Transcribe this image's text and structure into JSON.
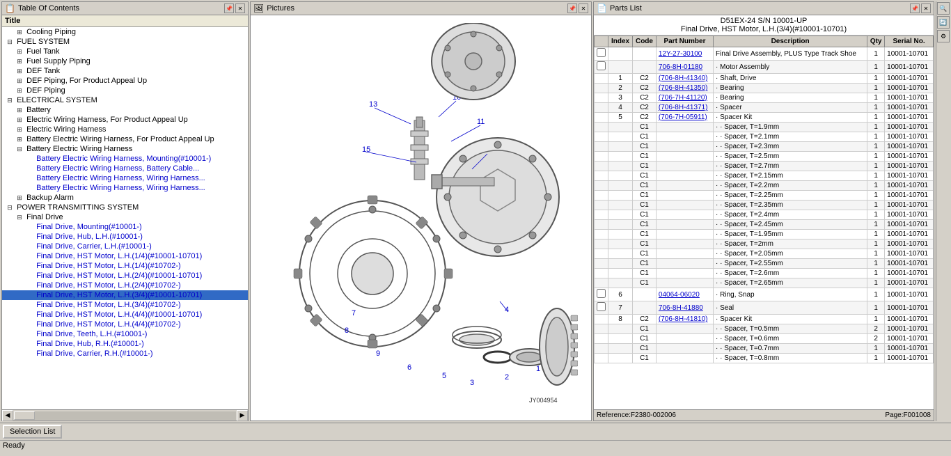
{
  "app": {
    "title": "Table Of Contents",
    "pictures_title": "Pictures",
    "parts_list_title": "Parts List"
  },
  "toc": {
    "title": "Title",
    "items": [
      {
        "id": "cooling",
        "label": "Cooling Piping",
        "indent": 2,
        "expandable": true,
        "type": "leaf"
      },
      {
        "id": "fuel_sys",
        "label": "FUEL SYSTEM",
        "indent": 1,
        "expandable": true,
        "type": "section"
      },
      {
        "id": "fuel_tank",
        "label": "Fuel Tank",
        "indent": 2,
        "expandable": true,
        "type": "leaf"
      },
      {
        "id": "fuel_supply",
        "label": "Fuel Supply Piping",
        "indent": 2,
        "expandable": true,
        "type": "leaf"
      },
      {
        "id": "def_tank",
        "label": "DEF Tank",
        "indent": 2,
        "expandable": true,
        "type": "leaf"
      },
      {
        "id": "def_piping_appeal",
        "label": "DEF Piping, For Product Appeal Up",
        "indent": 2,
        "expandable": true,
        "type": "leaf"
      },
      {
        "id": "def_piping",
        "label": "DEF Piping",
        "indent": 2,
        "expandable": true,
        "type": "leaf"
      },
      {
        "id": "elec_sys",
        "label": "ELECTRICAL SYSTEM",
        "indent": 1,
        "expandable": true,
        "type": "section"
      },
      {
        "id": "battery",
        "label": "Battery",
        "indent": 2,
        "expandable": true,
        "type": "leaf"
      },
      {
        "id": "elec_harness_appeal",
        "label": "Electric Wiring Harness, For Product Appeal Up",
        "indent": 2,
        "expandable": true,
        "type": "leaf"
      },
      {
        "id": "elec_harness",
        "label": "Electric Wiring Harness",
        "indent": 2,
        "expandable": true,
        "type": "leaf"
      },
      {
        "id": "battery_harness_appeal",
        "label": "Battery Electric Wiring Harness, For Product Appeal Up",
        "indent": 2,
        "expandable": true,
        "type": "leaf"
      },
      {
        "id": "battery_harness_main",
        "label": "Battery Electric Wiring Harness",
        "indent": 2,
        "expandable": true,
        "type": "section"
      },
      {
        "id": "battery_harness_mounting",
        "label": "Battery Electric Wiring Harness, Mounting(#10001-)",
        "indent": 3,
        "expandable": false,
        "type": "leaf"
      },
      {
        "id": "battery_cable",
        "label": "Battery Electric Wiring Harness, Battery Cable...",
        "indent": 3,
        "expandable": false,
        "type": "leaf"
      },
      {
        "id": "battery_wiring1",
        "label": "Battery Electric Wiring Harness, Wiring Harness...",
        "indent": 3,
        "expandable": false,
        "type": "leaf"
      },
      {
        "id": "battery_wiring2",
        "label": "Battery Electric Wiring Harness, Wiring Harness...",
        "indent": 3,
        "expandable": false,
        "type": "leaf"
      },
      {
        "id": "backup_alarm",
        "label": "Backup Alarm",
        "indent": 2,
        "expandable": true,
        "type": "leaf"
      },
      {
        "id": "power_trans",
        "label": "POWER TRANSMITTING SYSTEM",
        "indent": 1,
        "expandable": true,
        "type": "section"
      },
      {
        "id": "final_drive",
        "label": "Final Drive",
        "indent": 2,
        "expandable": true,
        "type": "section"
      },
      {
        "id": "final_drive_mounting",
        "label": "Final Drive, Mounting(#10001-)",
        "indent": 3,
        "expandable": false,
        "type": "leaf"
      },
      {
        "id": "final_drive_hub_lh",
        "label": "Final Drive, Hub, L.H.(#10001-)",
        "indent": 3,
        "expandable": false,
        "type": "leaf"
      },
      {
        "id": "final_drive_carrier_lh",
        "label": "Final Drive, Carrier, L.H.(#10001-)",
        "indent": 3,
        "expandable": false,
        "type": "leaf"
      },
      {
        "id": "final_drive_hst_lh_1_4_10001",
        "label": "Final Drive, HST Motor, L.H.(1/4)(#10001-10701)",
        "indent": 3,
        "expandable": false,
        "type": "leaf"
      },
      {
        "id": "final_drive_hst_lh_1_4_10702",
        "label": "Final Drive, HST Motor, L.H.(1/4)(#10702-)",
        "indent": 3,
        "expandable": false,
        "type": "leaf"
      },
      {
        "id": "final_drive_hst_lh_2_4_10001",
        "label": "Final Drive, HST Motor, L.H.(2/4)(#10001-10701)",
        "indent": 3,
        "expandable": false,
        "type": "leaf"
      },
      {
        "id": "final_drive_hst_lh_2_4_10702",
        "label": "Final Drive, HST Motor, L.H.(2/4)(#10702-)",
        "indent": 3,
        "expandable": false,
        "type": "leaf"
      },
      {
        "id": "final_drive_hst_lh_3_4_10001",
        "label": "Final Drive, HST Motor, L.H.(3/4)(#10001-10701)",
        "indent": 3,
        "expandable": false,
        "type": "leaf",
        "selected": true
      },
      {
        "id": "final_drive_hst_lh_3_4_10702",
        "label": "Final Drive, HST Motor, L.H.(3/4)(#10702-)",
        "indent": 3,
        "expandable": false,
        "type": "leaf"
      },
      {
        "id": "final_drive_hst_lh_4_4_10001",
        "label": "Final Drive, HST Motor, L.H.(4/4)(#10001-10701)",
        "indent": 3,
        "expandable": false,
        "type": "leaf"
      },
      {
        "id": "final_drive_hst_lh_4_4_10702",
        "label": "Final Drive, HST Motor, L.H.(4/4)(#10702-)",
        "indent": 3,
        "expandable": false,
        "type": "leaf"
      },
      {
        "id": "final_drive_teeth_lh",
        "label": "Final Drive, Teeth, L.H.(#10001-)",
        "indent": 3,
        "expandable": false,
        "type": "leaf"
      },
      {
        "id": "final_drive_hub_rh",
        "label": "Final Drive, Hub, R.H.(#10001-)",
        "indent": 3,
        "expandable": false,
        "type": "leaf"
      },
      {
        "id": "final_drive_carrier_rh",
        "label": "Final Drive, Carrier, R.H.(#10001-)",
        "indent": 3,
        "expandable": false,
        "type": "leaf"
      }
    ]
  },
  "parts_list": {
    "header_line1": "D51EX-24 S/N 10001-UP",
    "header_line2": "Final Drive, HST Motor, L.H.(3/4)(#10001-10701)",
    "columns": [
      "",
      "Index",
      "Code",
      "Part Number",
      "Description",
      "Qty",
      "Serial No."
    ],
    "rows": [
      {
        "cb": true,
        "index": "",
        "code": "",
        "part_num": "12Y-27-30100",
        "description": "Final Drive Assembly, PLUS Type Track Shoe",
        "qty": "1",
        "serial": "10001-10701"
      },
      {
        "cb": true,
        "index": "",
        "code": "",
        "part_num": "706-8H-01180",
        "description": "· Motor Assembly",
        "qty": "1",
        "serial": "10001-10701"
      },
      {
        "cb": false,
        "index": "1",
        "code": "C2",
        "part_num": "(706-8H-41340)",
        "description": "· Shaft, Drive",
        "qty": "1",
        "serial": "10001-10701"
      },
      {
        "cb": false,
        "index": "2",
        "code": "C2",
        "part_num": "(706-8H-41350)",
        "description": "· Bearing",
        "qty": "1",
        "serial": "10001-10701"
      },
      {
        "cb": false,
        "index": "3",
        "code": "C2",
        "part_num": "(706-7H-41120)",
        "description": "· Bearing",
        "qty": "1",
        "serial": "10001-10701"
      },
      {
        "cb": false,
        "index": "4",
        "code": "C2",
        "part_num": "(706-8H-41371)",
        "description": "· Spacer",
        "qty": "1",
        "serial": "10001-10701"
      },
      {
        "cb": false,
        "index": "5",
        "code": "C2",
        "part_num": "(706-7H-05911)",
        "description": "· Spacer Kit",
        "qty": "1",
        "serial": "10001-10701"
      },
      {
        "cb": false,
        "index": "",
        "code": "C1",
        "part_num": "",
        "description": "· · Spacer, T=1.9mm",
        "qty": "1",
        "serial": "10001-10701"
      },
      {
        "cb": false,
        "index": "",
        "code": "C1",
        "part_num": "",
        "description": "· · Spacer, T=2.1mm",
        "qty": "1",
        "serial": "10001-10701"
      },
      {
        "cb": false,
        "index": "",
        "code": "C1",
        "part_num": "",
        "description": "· · Spacer, T=2.3mm",
        "qty": "1",
        "serial": "10001-10701"
      },
      {
        "cb": false,
        "index": "",
        "code": "C1",
        "part_num": "",
        "description": "· · Spacer, T=2.5mm",
        "qty": "1",
        "serial": "10001-10701"
      },
      {
        "cb": false,
        "index": "",
        "code": "C1",
        "part_num": "",
        "description": "· · Spacer, T=2.7mm",
        "qty": "1",
        "serial": "10001-10701"
      },
      {
        "cb": false,
        "index": "",
        "code": "C1",
        "part_num": "",
        "description": "· · Spacer, T=2.15mm",
        "qty": "1",
        "serial": "10001-10701"
      },
      {
        "cb": false,
        "index": "",
        "code": "C1",
        "part_num": "",
        "description": "· · Spacer, T=2.2mm",
        "qty": "1",
        "serial": "10001-10701"
      },
      {
        "cb": false,
        "index": "",
        "code": "C1",
        "part_num": "",
        "description": "· · Spacer, T=2.25mm",
        "qty": "1",
        "serial": "10001-10701"
      },
      {
        "cb": false,
        "index": "",
        "code": "C1",
        "part_num": "",
        "description": "· · Spacer, T=2.35mm",
        "qty": "1",
        "serial": "10001-10701"
      },
      {
        "cb": false,
        "index": "",
        "code": "C1",
        "part_num": "",
        "description": "· · Spacer, T=2.4mm",
        "qty": "1",
        "serial": "10001-10701"
      },
      {
        "cb": false,
        "index": "",
        "code": "C1",
        "part_num": "",
        "description": "· · Spacer, T=2.45mm",
        "qty": "1",
        "serial": "10001-10701"
      },
      {
        "cb": false,
        "index": "",
        "code": "C1",
        "part_num": "",
        "description": "· · Spacer, T=1.95mm",
        "qty": "1",
        "serial": "10001-10701"
      },
      {
        "cb": false,
        "index": "",
        "code": "C1",
        "part_num": "",
        "description": "· · Spacer, T=2mm",
        "qty": "1",
        "serial": "10001-10701"
      },
      {
        "cb": false,
        "index": "",
        "code": "C1",
        "part_num": "",
        "description": "· · Spacer, T=2.05mm",
        "qty": "1",
        "serial": "10001-10701"
      },
      {
        "cb": false,
        "index": "",
        "code": "C1",
        "part_num": "",
        "description": "· · Spacer, T=2.55mm",
        "qty": "1",
        "serial": "10001-10701"
      },
      {
        "cb": false,
        "index": "",
        "code": "C1",
        "part_num": "",
        "description": "· · Spacer, T=2.6mm",
        "qty": "1",
        "serial": "10001-10701"
      },
      {
        "cb": false,
        "index": "",
        "code": "C1",
        "part_num": "",
        "description": "· · Spacer, T=2.65mm",
        "qty": "1",
        "serial": "10001-10701"
      },
      {
        "cb": true,
        "index": "6",
        "code": "",
        "part_num": "04064-06020",
        "description": "· Ring, Snap",
        "qty": "1",
        "serial": "10001-10701"
      },
      {
        "cb": true,
        "index": "7",
        "code": "",
        "part_num": "706-8H-41880",
        "description": "· Seal",
        "qty": "1",
        "serial": "10001-10701"
      },
      {
        "cb": false,
        "index": "8",
        "code": "C2",
        "part_num": "(706-8H-41810)",
        "description": "· Spacer Kit",
        "qty": "1",
        "serial": "10001-10701"
      },
      {
        "cb": false,
        "index": "",
        "code": "C1",
        "part_num": "",
        "description": "· · Spacer, T=0.5mm",
        "qty": "2",
        "serial": "10001-10701"
      },
      {
        "cb": false,
        "index": "",
        "code": "C1",
        "part_num": "",
        "description": "· · Spacer, T=0.6mm",
        "qty": "2",
        "serial": "10001-10701"
      },
      {
        "cb": false,
        "index": "",
        "code": "C1",
        "part_num": "",
        "description": "· · Spacer, T=0.7mm",
        "qty": "1",
        "serial": "10001-10701"
      },
      {
        "cb": false,
        "index": "",
        "code": "C1",
        "part_num": "",
        "description": "· · Spacer, T=0.8mm",
        "qty": "1",
        "serial": "10001-10701"
      }
    ],
    "footer_reference": "Reference:F2380-002006",
    "footer_page": "Page:F001008"
  },
  "status_bar": {
    "text": "Ready"
  },
  "selection_list_btn": "Selection List",
  "colors": {
    "header_bg": "#d4d0c8",
    "selected_bg": "#316ac5",
    "selected_fg": "#ffffff",
    "link_color": "#0000cc",
    "table_header_bg": "#d4d0c8"
  }
}
